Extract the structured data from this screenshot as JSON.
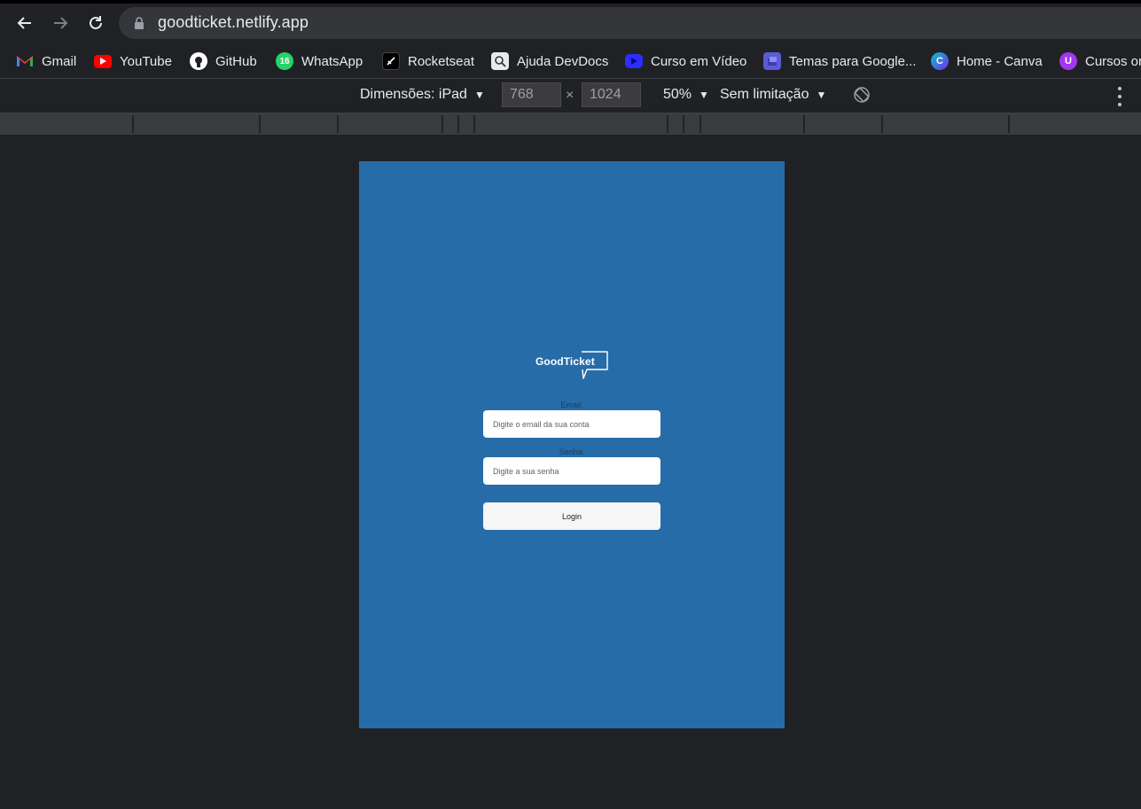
{
  "browser": {
    "url": "goodticket.netlify.app"
  },
  "bookmarks": [
    {
      "label": "Gmail",
      "icon": "gmail-icon",
      "color": "#ea4335"
    },
    {
      "label": "YouTube",
      "icon": "youtube-icon",
      "color": "#ff0000"
    },
    {
      "label": "GitHub",
      "icon": "github-icon",
      "color": "#ffffff"
    },
    {
      "label": "WhatsApp",
      "icon": "whatsapp-icon",
      "color": "#25d366",
      "badge": "16"
    },
    {
      "label": "Rocketseat",
      "icon": "rocketseat-icon",
      "color": "#000000"
    },
    {
      "label": "Ajuda DevDocs",
      "icon": "devdocs-icon",
      "color": "#e8eaed"
    },
    {
      "label": "Curso em Vídeo",
      "icon": "cursoemvideo-icon",
      "color": "#2d2dff"
    },
    {
      "label": "Temas para Google...",
      "icon": "temas-icon",
      "color": "#5b5bd6"
    },
    {
      "label": "Home - Canva",
      "icon": "canva-icon",
      "color": "#7d2ae8"
    },
    {
      "label": "Cursos or",
      "icon": "udemy-icon",
      "color": "#a435f0"
    }
  ],
  "device_toolbar": {
    "dimensions_label": "Dimensões: iPad",
    "width_value": "768",
    "times": "×",
    "height_value": "1024",
    "zoom": "50%",
    "throttle": "Sem limitação"
  },
  "app": {
    "brand": "GoodTicket",
    "background_color": "#266ca9",
    "email_label": "Email:",
    "email_placeholder": "Digite o email da sua conta",
    "password_label": "Senha:",
    "password_placeholder": "Digite a sua senha",
    "login_label": "Login"
  }
}
